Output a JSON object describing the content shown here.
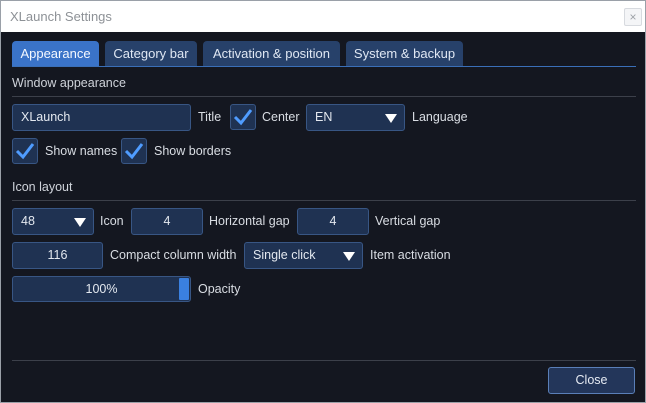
{
  "window": {
    "title": "XLaunch Settings",
    "close_glyph": "×"
  },
  "tabs": [
    {
      "label": "Appearance",
      "active": true
    },
    {
      "label": "Category bar",
      "active": false
    },
    {
      "label": "Activation & position",
      "active": false
    },
    {
      "label": "System & backup",
      "active": false
    }
  ],
  "window_appearance": {
    "section_label": "Window appearance",
    "title_value": "XLaunch",
    "title_label": "Title",
    "center_checked": true,
    "center_label": "Center",
    "language_value": "EN",
    "language_label": "Language",
    "show_names_checked": true,
    "show_names_label": "Show names",
    "show_borders_checked": true,
    "show_borders_label": "Show borders"
  },
  "icon_layout": {
    "section_label": "Icon layout",
    "icon_size_value": "48",
    "icon_label": "Icon",
    "hgap_value": "4",
    "hgap_label": "Horizontal gap",
    "vgap_value": "4",
    "vgap_label": "Vertical gap",
    "compact_width_value": "116",
    "compact_width_label": "Compact column width",
    "activation_value": "Single click",
    "activation_label": "Item activation",
    "opacity_value": "100%",
    "opacity_fraction": 1.0,
    "opacity_label": "Opacity"
  },
  "footer": {
    "close_label": "Close"
  },
  "colors": {
    "accent": "#3a80e0",
    "background": "#141720",
    "field": "#1f3252"
  }
}
